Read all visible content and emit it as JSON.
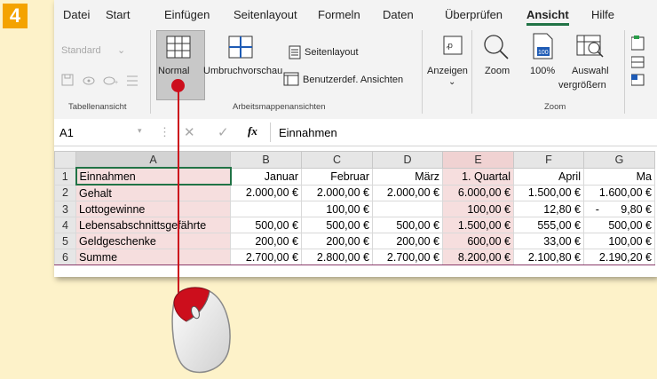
{
  "step_number": "4",
  "menu_tabs": [
    "Datei",
    "Start",
    "Einfügen",
    "Seitenlayout",
    "Formeln",
    "Daten",
    "Überprüfen",
    "Ansicht",
    "Hilfe"
  ],
  "active_tab": "Ansicht",
  "ribbon": {
    "sheet_view_select": "Standard",
    "group_tabellenansicht": "Tabellenansicht",
    "normal": "Normal",
    "umbruchvorschau": "Umbruchvorschau",
    "seitenlayout": "Seitenlayout",
    "benutzerdef": "Benutzerdef. Ansichten",
    "group_arbeitsmappen": "Arbeitsmappenansichten",
    "anzeigen": "Anzeigen",
    "zoom": "Zoom",
    "zoom100": "100%",
    "zoom100_icon_label": "100",
    "auswahl_line1": "Auswahl",
    "auswahl_line2": "vergrößern",
    "group_zoom": "Zoom"
  },
  "formula_bar": {
    "name_box": "A1",
    "fx": "fx",
    "value": "Einnahmen"
  },
  "columns": [
    "A",
    "B",
    "C",
    "D",
    "E",
    "F",
    "G"
  ],
  "rows": [
    {
      "n": "1",
      "cells": [
        "Einnahmen",
        "Januar",
        "Februar",
        "März",
        "1. Quartal",
        "April",
        "Ma"
      ]
    },
    {
      "n": "2",
      "cells": [
        "Gehalt",
        "2.000,00 €",
        "2.000,00 €",
        "2.000,00 €",
        "6.000,00 €",
        "1.500,00 €",
        "1.600,00 €"
      ]
    },
    {
      "n": "3",
      "cells": [
        "Lottogewinne",
        "",
        "100,00 €",
        "",
        "100,00 €",
        "12,80 €",
        "-       9,80 €"
      ]
    },
    {
      "n": "4",
      "cells": [
        "Lebensabschnittsgefährte",
        "500,00 €",
        "500,00 €",
        "500,00 €",
        "1.500,00 €",
        "555,00 €",
        "500,00 €"
      ]
    },
    {
      "n": "5",
      "cells": [
        "Geldgeschenke",
        "200,00 €",
        "200,00 €",
        "200,00 €",
        "600,00 €",
        "33,00 €",
        "100,00 €"
      ]
    },
    {
      "n": "6",
      "cells": [
        "Summe",
        "2.700,00 €",
        "2.800,00 €",
        "2.700,00 €",
        "8.200,00 €",
        "2.100,80 €",
        "2.190,20 €"
      ]
    }
  ],
  "colors": {
    "accent_red": "#cc0e1c",
    "excel_green": "#217346",
    "background": "#fdf2c9",
    "step_badge": "#f4a300"
  }
}
